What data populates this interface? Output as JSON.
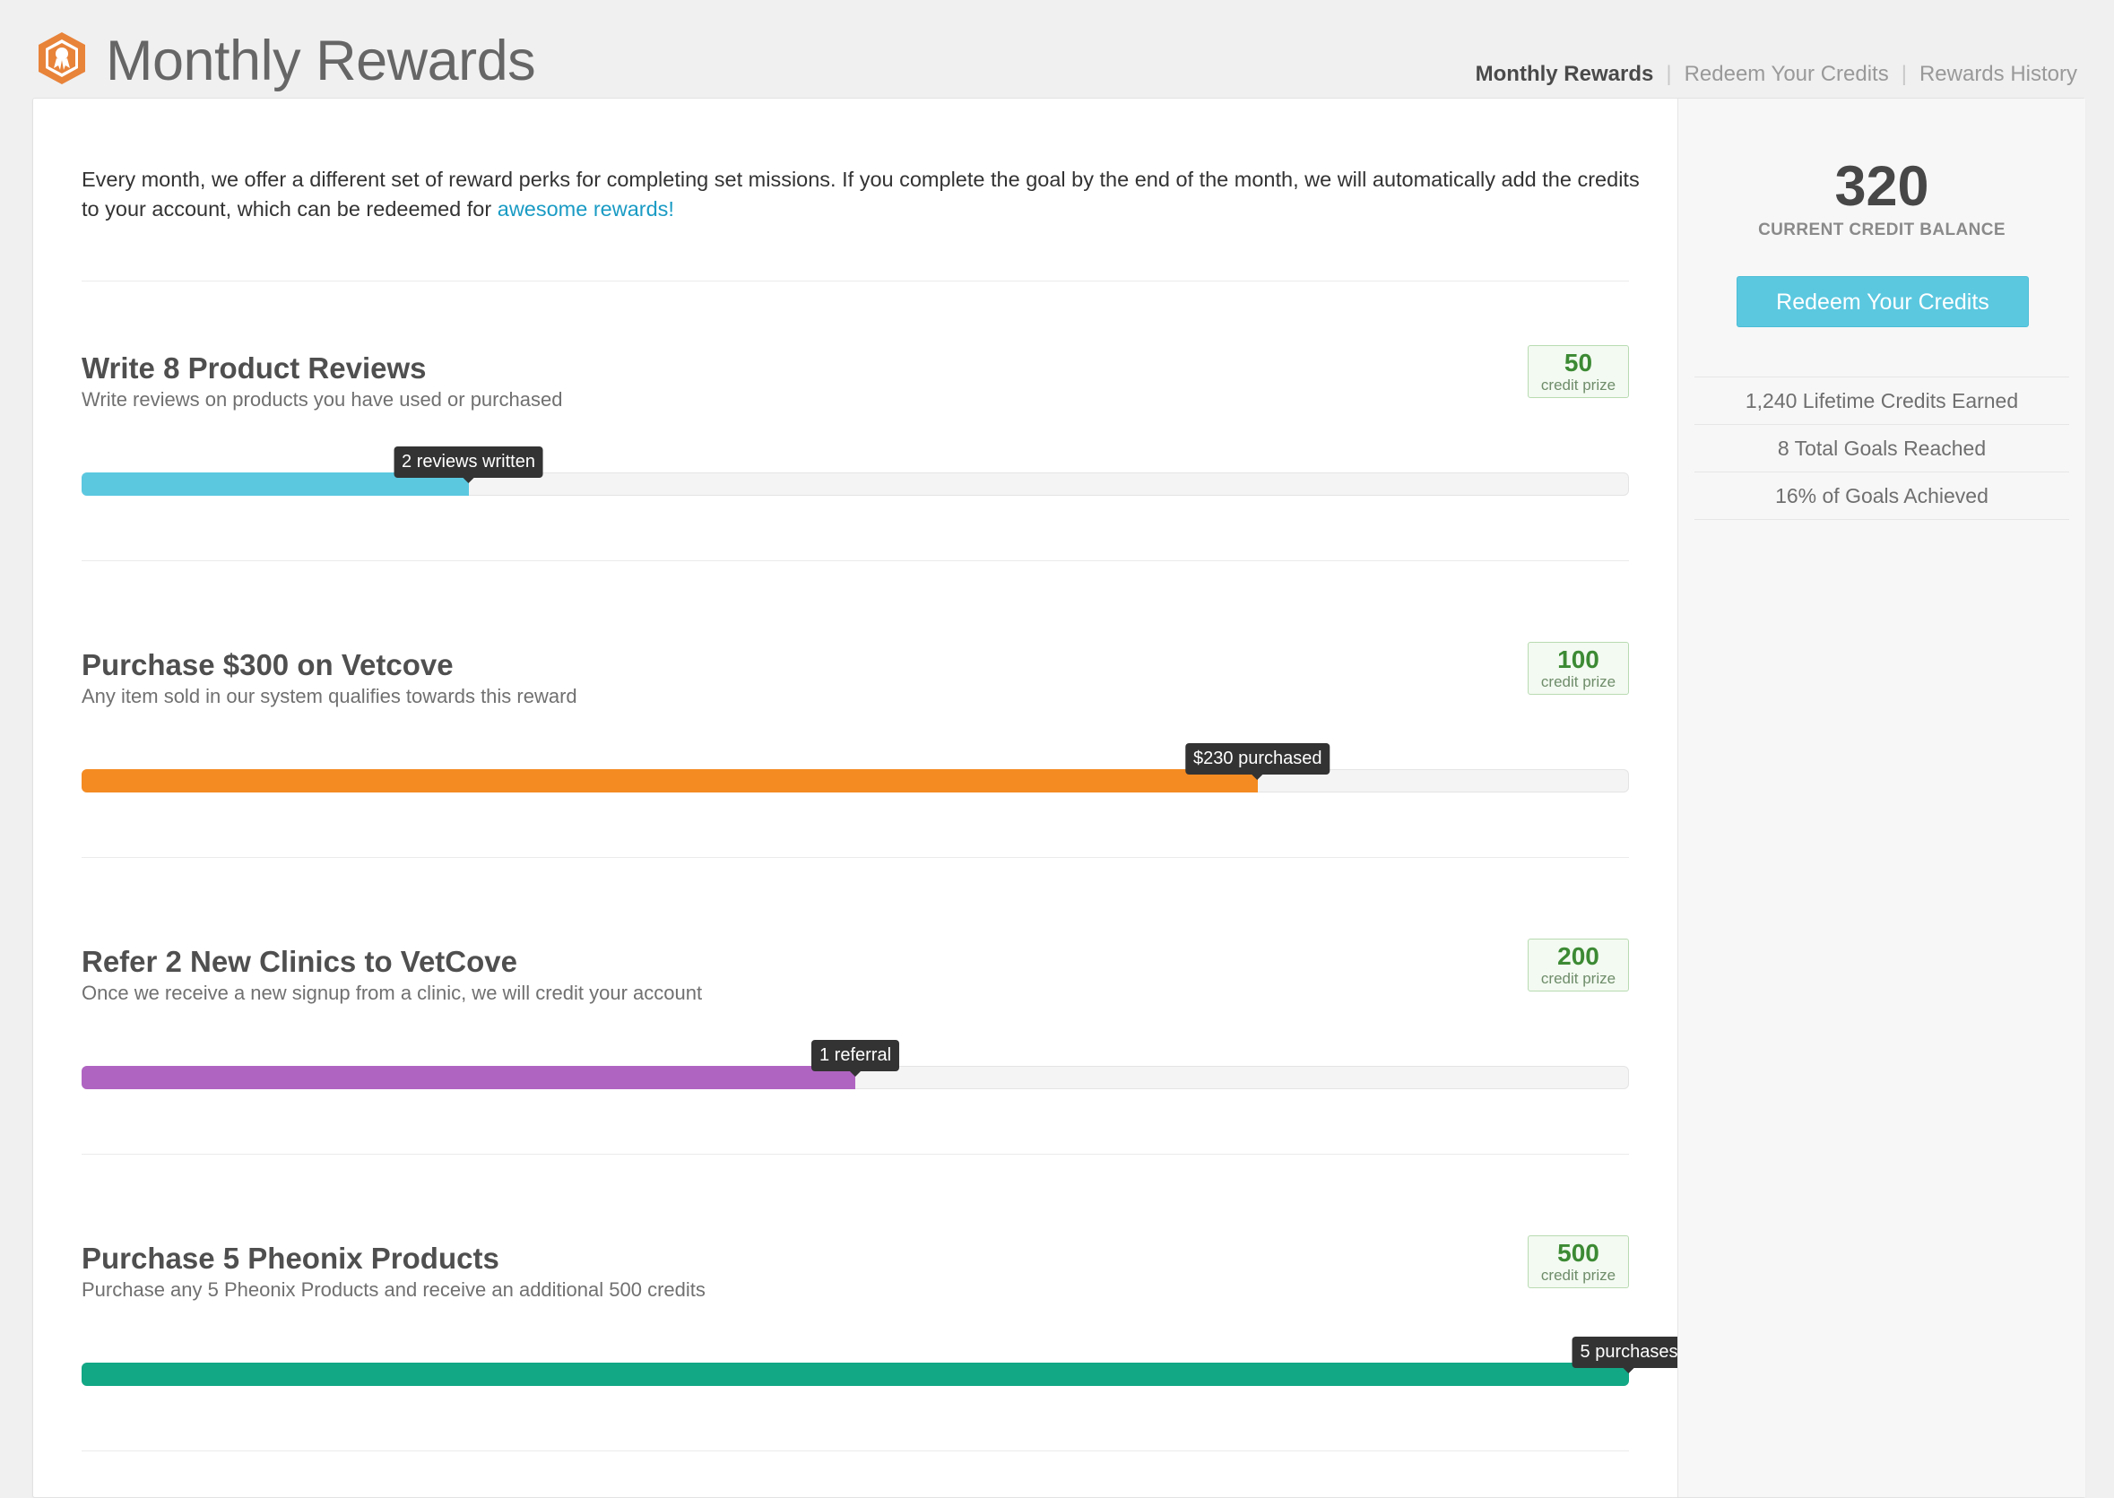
{
  "header": {
    "title": "Monthly Rewards",
    "nav": [
      {
        "label": "Monthly Rewards",
        "active": true
      },
      {
        "label": "Redeem Your Credits",
        "active": false
      },
      {
        "label": "Rewards History",
        "active": false
      }
    ],
    "logo_icon": "award-ribbon-hexagon-icon",
    "brand_color": "#e8833a"
  },
  "intro": {
    "text": "Every month, we offer a different set of reward perks for completing set missions. If you complete the goal by the end of the month, we will automatically add the credits to your account, which can be redeemed for ",
    "link": "awesome rewards!"
  },
  "goals": [
    {
      "title": "Write 8 Product Reviews",
      "description": "Write reviews on products you have used or purchased",
      "prize_value": "50",
      "prize_label": "credit prize",
      "progress_label": "2 reviews written",
      "progress": 0.25,
      "color": "#5bc8e0"
    },
    {
      "title": "Purchase $300 on Vetcove",
      "description": "Any item sold in our system qualifies towards this reward",
      "prize_value": "100",
      "prize_label": "credit prize",
      "progress_label": "$230 purchased",
      "progress": 0.76,
      "color": "#f48b22"
    },
    {
      "title": "Refer 2 New Clinics to VetCove",
      "description": "Once we receive a new signup from a clinic, we will credit your account",
      "prize_value": "200",
      "prize_label": "credit prize",
      "progress_label": "1 referral",
      "progress": 0.5,
      "color": "#b064c2"
    },
    {
      "title": "Purchase 5 Pheonix Products",
      "description": "Purchase any 5 Pheonix Products and receive an additional 500 credits",
      "prize_value": "500",
      "prize_label": "credit prize",
      "progress_label": "5 purchases",
      "progress": 1.0,
      "color": "#12a785"
    }
  ],
  "sidebar": {
    "balance": "320",
    "balance_label": "CURRENT CREDIT BALANCE",
    "redeem_button": "Redeem Your Credits",
    "stats": [
      "1,240 Lifetime Credits Earned",
      "8 Total Goals Reached",
      "16% of Goals Achieved"
    ]
  }
}
